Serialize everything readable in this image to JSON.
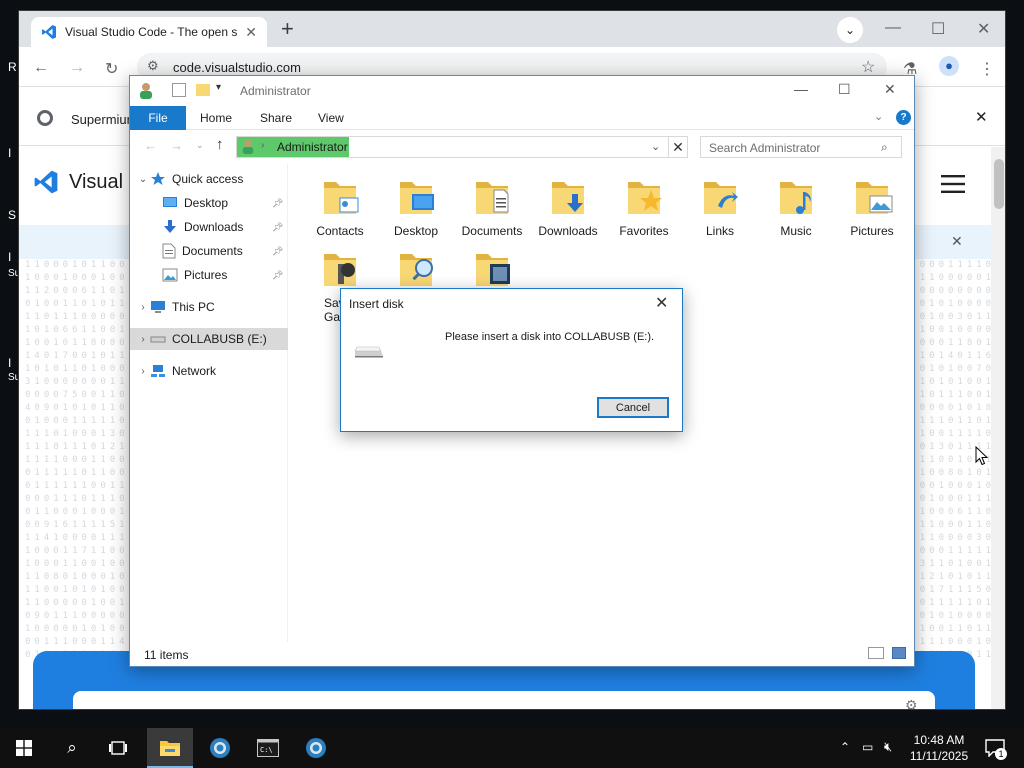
{
  "desktop": {
    "icon_labels": [
      "R",
      "I",
      "S",
      "I",
      "Su",
      "I",
      "Su"
    ]
  },
  "browser": {
    "tab_title": "Visual Studio Code - The open s",
    "url": "code.visualstudio.com",
    "infobar_text": "Supermium",
    "site_title": "Visual S"
  },
  "explorer": {
    "title": "Administrator",
    "ribbon": {
      "file": "File",
      "tabs": [
        "Home",
        "Share",
        "View"
      ]
    },
    "address": "Administrator",
    "search_placeholder": "Search Administrator",
    "nav": {
      "quick_access": "Quick access",
      "quick_items": [
        "Desktop",
        "Downloads",
        "Documents",
        "Pictures"
      ],
      "this_pc": "This PC",
      "drive": "COLLABUSB (E:)",
      "network": "Network"
    },
    "folders": [
      "Contacts",
      "Desktop",
      "Documents",
      "Downloads",
      "Favorites",
      "Links",
      "Music",
      "Pictures",
      "Sav",
      "Gar"
    ],
    "status": "11 items"
  },
  "dialog": {
    "title": "Insert disk",
    "message": "Please insert a disk into COLLABUSB (E:).",
    "cancel": "Cancel"
  },
  "taskbar": {
    "time": "10:48 AM",
    "date": "11/11/2025",
    "notification_count": "1"
  },
  "colors": {
    "accent": "#1979ca",
    "hero": "#1f7fe0",
    "folder": "#f8d775"
  }
}
